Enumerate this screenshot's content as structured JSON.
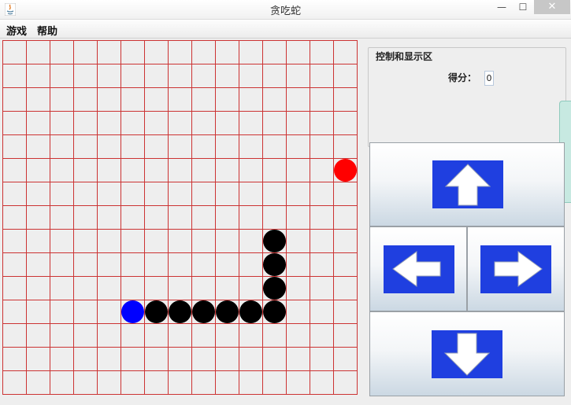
{
  "window": {
    "title": "贪吃蛇",
    "minimize_label": "—",
    "maximize_label": "☐",
    "close_label": "✕"
  },
  "menu": {
    "items": [
      "游戏",
      "帮助"
    ]
  },
  "board": {
    "cols": 15,
    "rows": 15,
    "grid_color": "#cc3333",
    "background": "#eeeeee",
    "food": {
      "col": 14,
      "row": 5,
      "color": "#ff0000"
    },
    "snake_head": {
      "col": 5,
      "row": 11,
      "color": "#0000ff"
    },
    "snake_body": [
      {
        "col": 6,
        "row": 11
      },
      {
        "col": 7,
        "row": 11
      },
      {
        "col": 8,
        "row": 11
      },
      {
        "col": 9,
        "row": 11
      },
      {
        "col": 10,
        "row": 11
      },
      {
        "col": 11,
        "row": 11
      },
      {
        "col": 11,
        "row": 10
      },
      {
        "col": 11,
        "row": 9
      },
      {
        "col": 11,
        "row": 8
      }
    ],
    "body_color": "#000000"
  },
  "panel": {
    "group_title": "控制和显示区",
    "score_label": "得分：",
    "score_value": "0"
  },
  "controls": {
    "up": {
      "icon": "arrow-up-icon"
    },
    "left": {
      "icon": "arrow-left-icon"
    },
    "right": {
      "icon": "arrow-right-icon"
    },
    "down": {
      "icon": "arrow-down-icon"
    },
    "icon_color": "#1f3fe0"
  }
}
